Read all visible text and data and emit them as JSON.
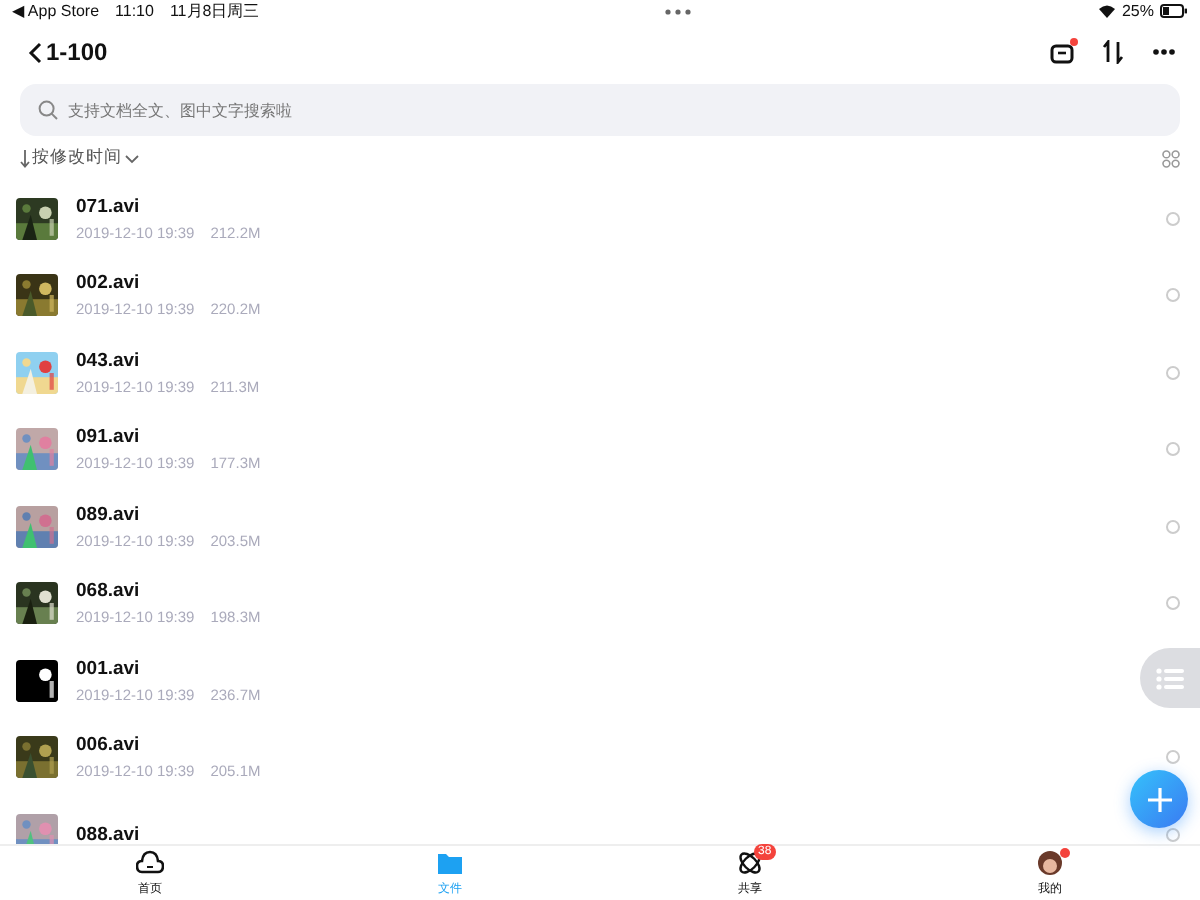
{
  "status_bar": {
    "back_app": "◀ App Store",
    "time": "11:10",
    "date": "11月8日周三",
    "battery": "25%"
  },
  "header": {
    "title": "1-100",
    "has_notification": true
  },
  "search": {
    "placeholder": "支持文档全文、图中文字搜索啦"
  },
  "sort": {
    "label": "按修改时间"
  },
  "files": [
    {
      "name": "071.avi",
      "date": "2019-12-10 19:39",
      "size": "212.2M",
      "selected": false
    },
    {
      "name": "002.avi",
      "date": "2019-12-10 19:39",
      "size": "220.2M",
      "selected": false
    },
    {
      "name": "043.avi",
      "date": "2019-12-10 19:39",
      "size": "211.3M",
      "selected": false
    },
    {
      "name": "091.avi",
      "date": "2019-12-10 19:39",
      "size": "177.3M",
      "selected": false
    },
    {
      "name": "089.avi",
      "date": "2019-12-10 19:39",
      "size": "203.5M",
      "selected": false
    },
    {
      "name": "068.avi",
      "date": "2019-12-10 19:39",
      "size": "198.3M",
      "selected": false
    },
    {
      "name": "001.avi",
      "date": "2019-12-10 19:39",
      "size": "236.7M"
    },
    {
      "name": "006.avi",
      "date": "2019-12-10 19:39",
      "size": "205.1M",
      "selected": false
    },
    {
      "name": "088.avi",
      "selected": false
    }
  ],
  "tabs": [
    {
      "kind": "home",
      "label": "首页",
      "selected": false
    },
    {
      "kind": "files",
      "label": "文件",
      "selected": true
    },
    {
      "kind": "share",
      "label": "共享",
      "selected": false,
      "badge": "38"
    },
    {
      "kind": "me",
      "label": "我的",
      "selected": false,
      "dot": true
    }
  ]
}
